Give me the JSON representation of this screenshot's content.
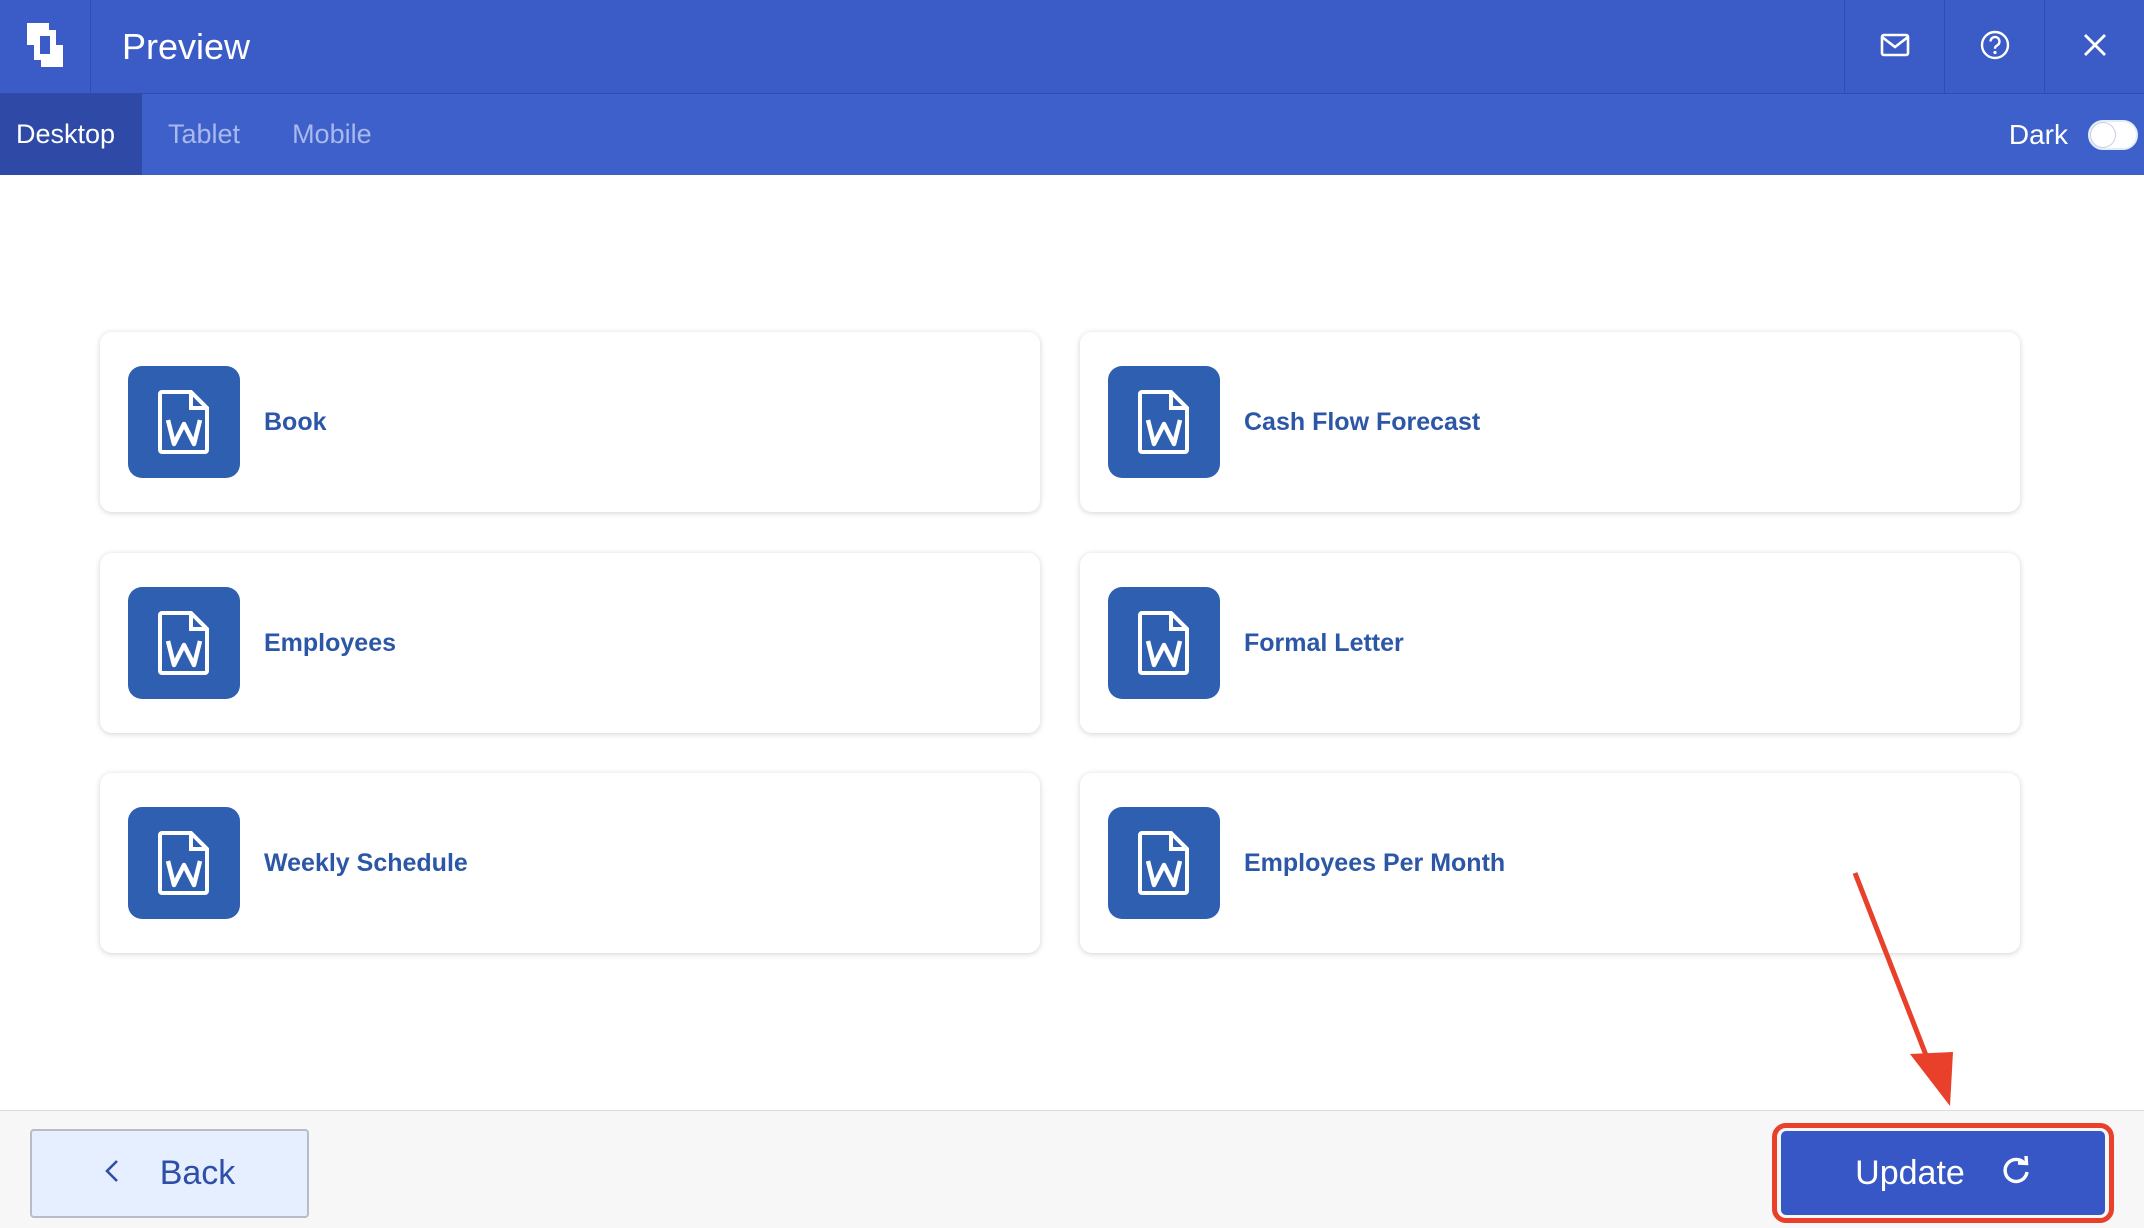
{
  "header": {
    "title": "Preview",
    "logo_icon": "bracket-logo-icon",
    "actions": [
      {
        "icon": "mail-icon"
      },
      {
        "icon": "help-circle-icon"
      },
      {
        "icon": "close-icon"
      }
    ]
  },
  "tabs": {
    "items": [
      {
        "label": "Desktop",
        "active": true
      },
      {
        "label": "Tablet",
        "active": false
      },
      {
        "label": "Mobile",
        "active": false
      }
    ],
    "dark_label": "Dark",
    "dark_enabled": false
  },
  "cards": [
    {
      "label": "Book",
      "icon": "word-document-icon"
    },
    {
      "label": "Cash Flow Forecast",
      "icon": "word-document-icon"
    },
    {
      "label": "Employees",
      "icon": "word-document-icon"
    },
    {
      "label": "Formal Letter",
      "icon": "word-document-icon"
    },
    {
      "label": "Weekly Schedule",
      "icon": "word-document-icon"
    },
    {
      "label": "Employees Per Month",
      "icon": "word-document-icon"
    }
  ],
  "footer": {
    "back_label": "Back",
    "update_label": "Update",
    "update_icon": "refresh-icon",
    "back_icon": "chevron-left-icon"
  },
  "colors": {
    "header": "#3b5bc7",
    "tabbar": "#3e60ca",
    "active_tab": "#2e4aa6",
    "accent": "#3757c7",
    "card_text": "#2c57a6",
    "annotation": "#e8402a"
  }
}
